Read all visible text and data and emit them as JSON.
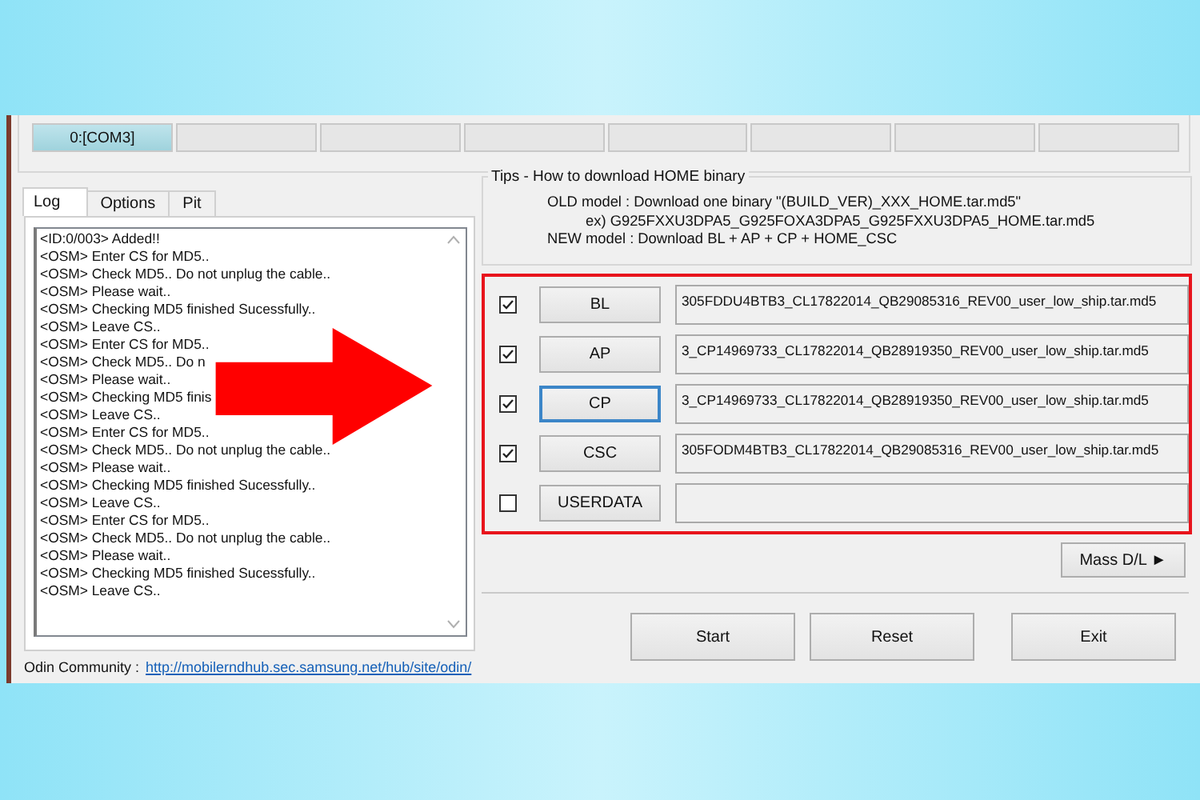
{
  "device_slots": [
    {
      "label": "0:[COM3]",
      "active": true
    },
    {
      "active": false
    },
    {
      "active": false
    },
    {
      "active": false
    },
    {
      "active": false
    },
    {
      "active": false
    },
    {
      "active": false
    },
    {
      "active": false
    }
  ],
  "tabs": [
    {
      "label": "Log",
      "selected": true
    },
    {
      "label": "Options",
      "selected": false
    },
    {
      "label": "Pit",
      "selected": false
    }
  ],
  "log": [
    "<ID:0/003> Added!!",
    "<OSM> Enter CS for MD5..",
    "<OSM> Check MD5.. Do not unplug the cable..",
    "<OSM> Please wait..",
    "<OSM> Checking MD5 finished Sucessfully..",
    "<OSM> Leave CS..",
    "<OSM> Enter CS for MD5..",
    "<OSM> Check MD5.. Do n",
    "<OSM> Please wait..",
    "<OSM> Checking MD5 finis",
    "<OSM> Leave CS..",
    "<OSM> Enter CS for MD5..",
    "<OSM> Check MD5.. Do not unplug the cable..",
    "<OSM> Please wait..",
    "<OSM> Checking MD5 finished Sucessfully..",
    "<OSM> Leave CS..",
    "<OSM> Enter CS for MD5..",
    "<OSM> Check MD5.. Do not unplug the cable..",
    "<OSM> Please wait..",
    "<OSM> Checking MD5 finished Sucessfully..",
    "<OSM> Leave CS.."
  ],
  "tips": {
    "title": "Tips - How to download HOME binary",
    "old_model": "OLD model  : Download one binary    \"(BUILD_VER)_XXX_HOME.tar.md5\"",
    "example": "ex) G925FXXU3DPA5_G925FOXA3DPA5_G925FXXU3DPA5_HOME.tar.md5",
    "new_model": "NEW model : Download BL  + AP + CP + HOME_CSC"
  },
  "files_highlighted": true,
  "files": [
    {
      "checked": true,
      "button": "BL",
      "focused": false,
      "value": "305FDDU4BTB3_CL17822014_QB29085316_REV00_user_low_ship.tar.md5"
    },
    {
      "checked": true,
      "button": "AP",
      "focused": false,
      "value": "3_CP14969733_CL17822014_QB28919350_REV00_user_low_ship.tar.md5"
    },
    {
      "checked": true,
      "button": "CP",
      "focused": true,
      "value": "3_CP14969733_CL17822014_QB28919350_REV00_user_low_ship.tar.md5"
    },
    {
      "checked": true,
      "button": "CSC",
      "focused": false,
      "value": "305FODM4BTB3_CL17822014_QB29085316_REV00_user_low_ship.tar.md5"
    },
    {
      "checked": false,
      "button": "USERDATA",
      "focused": false
    }
  ],
  "mass_dl": "Mass D/L ►",
  "buttons": [
    "Start",
    "Reset",
    "Exit"
  ],
  "footer": {
    "label": "Odin Community :",
    "link": "http://mobilerndhub.sec.samsung.net/hub/site/odin/"
  },
  "annotation_arrow": true
}
